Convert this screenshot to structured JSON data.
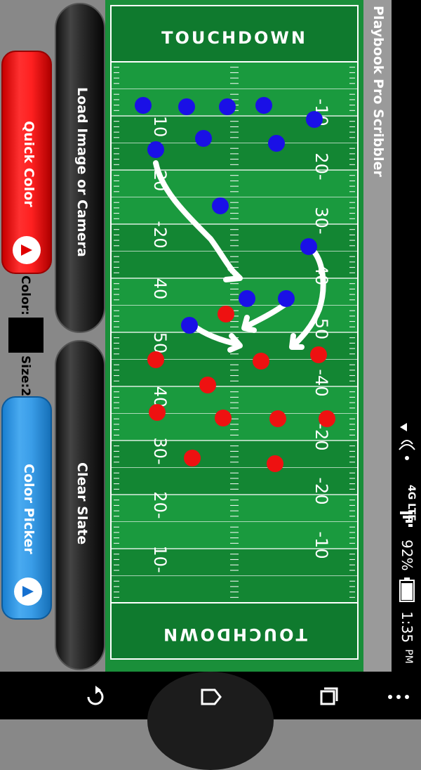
{
  "app": {
    "title": "Playbook Pro Scribbler"
  },
  "status_bar": {
    "network": "4G LTE",
    "battery": "92%",
    "time": "1:35",
    "ampm": "PM"
  },
  "buttons": {
    "load_image": "Load Image or Camera",
    "clear_slate": "Clear Slate",
    "quick_color": "Quick Color",
    "color_picker": "Color Picker"
  },
  "brush": {
    "color_label": "Color:",
    "size_label": "Size:2",
    "color_value": "#000000"
  },
  "field": {
    "endzone_top": "TOUCHDOWN",
    "endzone_bottom": "TOUCHDOWN",
    "yard_numbers_left": [
      "10",
      "20",
      "-20",
      "40",
      "50",
      "40",
      "30-",
      "20-",
      "10-"
    ],
    "yard_numbers_right": [
      "-10",
      "20-",
      "30-",
      "40",
      "50",
      "-40",
      "-20",
      "-20",
      "-10"
    ]
  },
  "players": {
    "blue_color": "#1a10e6",
    "red_color": "#ee1111"
  },
  "nav": {
    "back": "back-icon",
    "home": "home-icon",
    "recents": "recents-icon",
    "menu": "menu-icon"
  }
}
